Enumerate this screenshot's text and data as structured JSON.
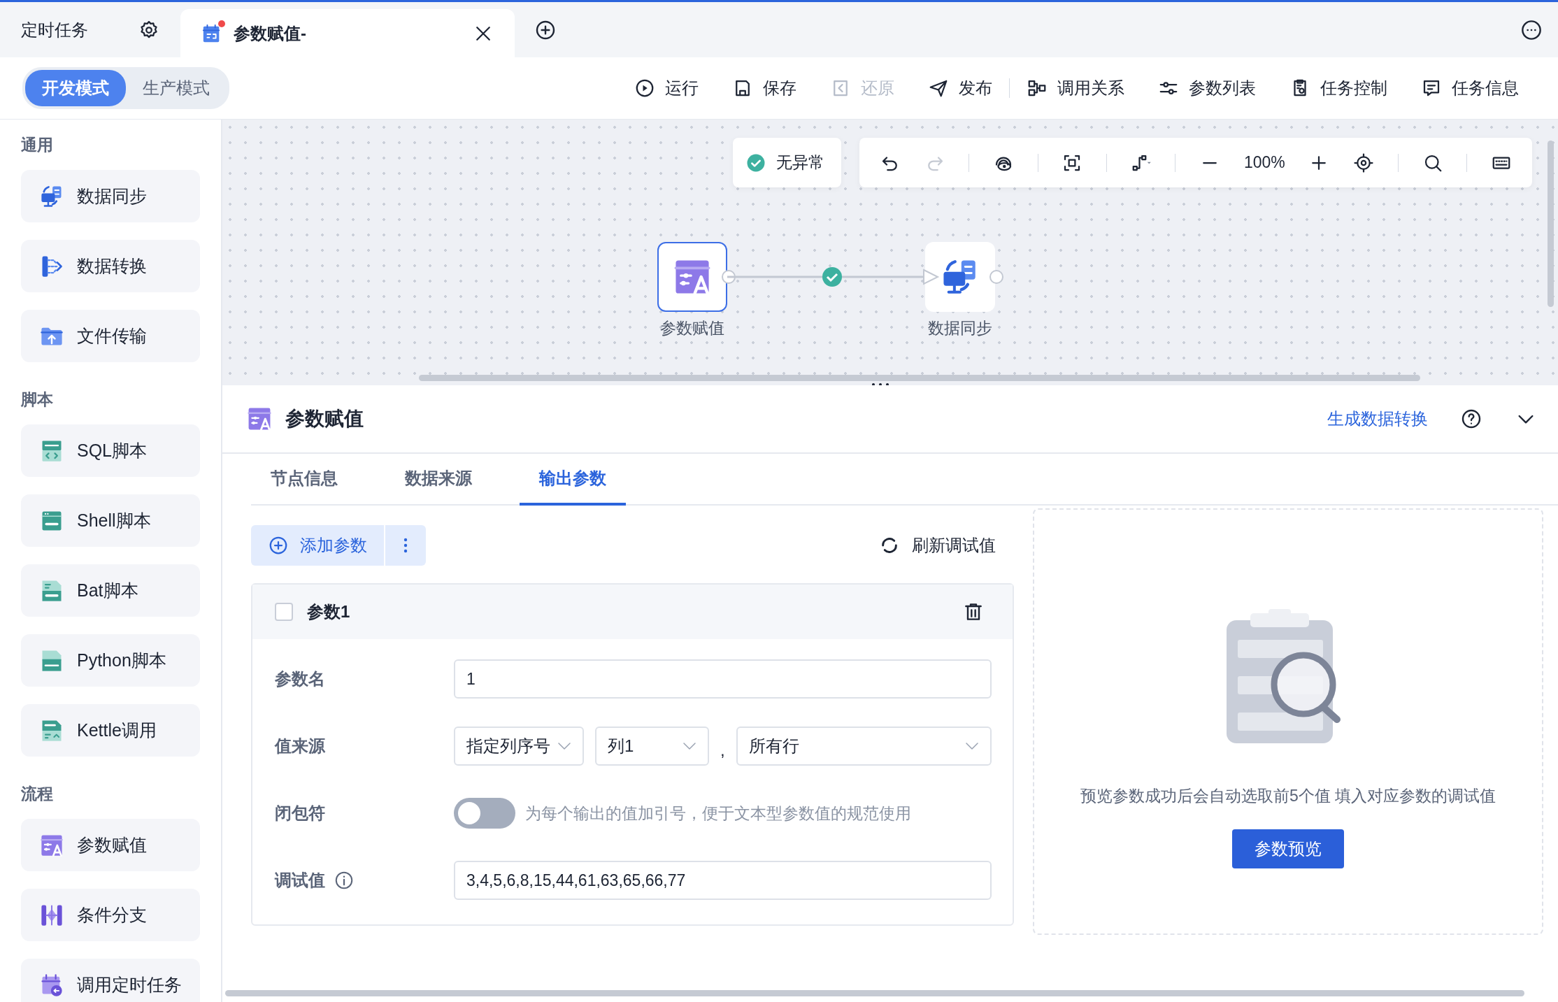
{
  "tabs": [
    {
      "label": "定时任务",
      "selected": false
    },
    {
      "label": "参数赋值-",
      "selected": true,
      "unsaved": true
    }
  ],
  "modes": [
    {
      "label": "开发模式",
      "selected": true
    },
    {
      "label": "生产模式",
      "selected": false
    }
  ],
  "action_groups": [
    [
      {
        "label": "运行",
        "disabled": false
      },
      {
        "label": "保存",
        "disabled": false
      },
      {
        "label": "还原",
        "disabled": true
      },
      {
        "label": "发布",
        "disabled": false
      }
    ],
    [
      {
        "label": "调用关系",
        "disabled": false
      },
      {
        "label": "参数列表",
        "disabled": false
      },
      {
        "label": "任务控制",
        "disabled": false
      },
      {
        "label": "任务信息",
        "disabled": false
      }
    ]
  ],
  "sidebar": {
    "sections": [
      {
        "title": "通用",
        "items": [
          "数据同步",
          "数据转换",
          "文件传输"
        ]
      },
      {
        "title": "脚本",
        "items": [
          "SQL脚本",
          "Shell脚本",
          "Bat脚本",
          "Python脚本",
          "Kettle调用"
        ]
      },
      {
        "title": "流程",
        "items": [
          "参数赋值",
          "条件分支",
          "调用定时任务"
        ]
      }
    ]
  },
  "canvas": {
    "status": {
      "label": "无异常",
      "ok": true
    },
    "redo_disabled": true,
    "zoom": "100%",
    "nodes": [
      {
        "label": "参数赋值",
        "selected": true
      },
      {
        "label": "数据同步",
        "selected": false
      }
    ],
    "edge": {
      "ok": true
    }
  },
  "detail": {
    "title": "参数赋值",
    "link": "生成数据转换",
    "expanded": true,
    "tabs": [
      {
        "label": "节点信息",
        "selected": false
      },
      {
        "label": "数据来源",
        "selected": false
      },
      {
        "label": "输出参数",
        "selected": true
      }
    ],
    "add_button": "添加参数",
    "refresh_button": "刷新调试值",
    "params": [
      {
        "title": "参数1",
        "checked": false,
        "fields": [
          {
            "kind": "text",
            "label": "参数名",
            "value": "1"
          },
          {
            "kind": "selects",
            "label": "值来源",
            "selects": [
              "指定列序号",
              "列1",
              "所有行"
            ],
            "separator": ","
          },
          {
            "kind": "toggle",
            "label": "闭包符",
            "on": false,
            "hint": "为每个输出的值加引号，便于文本型参数值的规范使用"
          },
          {
            "kind": "text",
            "label": "调试值",
            "info": true,
            "value": "3,4,5,6,8,15,44,61,63,65,66,77"
          }
        ]
      }
    ]
  },
  "preview": {
    "text": "预览参数成功后会自动选取前5个值 填入对应参数的调试值",
    "button": "参数预览"
  }
}
